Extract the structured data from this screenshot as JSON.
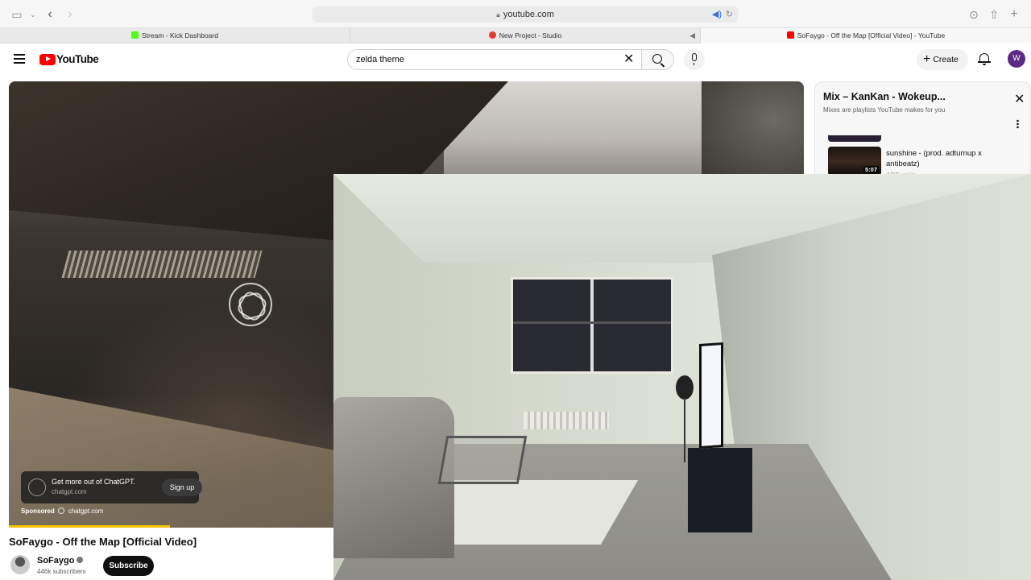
{
  "browser": {
    "url": "youtube.com",
    "tabs": [
      {
        "label": "Stream - Kick Dashboard",
        "fav_color": "#53fc18"
      },
      {
        "label": "New Project - Studio",
        "fav_color": "#e53935"
      },
      {
        "label": "SoFaygo - Off the Map [Official Video] - YouTube",
        "fav_color": "#ff0000"
      }
    ]
  },
  "youtube": {
    "logo_text": "YouTube",
    "search_value": "zelda theme",
    "create_label": "Create",
    "avatar_letter": "W"
  },
  "ad": {
    "title": "Get more out of ChatGPT.",
    "url": "chatgpt.com",
    "signup_label": "Sign up",
    "sponsored_label": "Sponsored",
    "sponsor_url": "chatgpt.com"
  },
  "video": {
    "title": "SoFaygo - Off the Map [Official Video]",
    "channel": "SoFaygo",
    "subscribers": "446k subscribers",
    "subscribe_label": "Subscribe"
  },
  "mix": {
    "title": "Mix – KanKan - Wokeup...",
    "subtitle": "Mixes are playlists YouTube makes for you",
    "item_title": "sunshine - (prod. adturnup x antibeatz)",
    "item_duration": "5:07",
    "item_artist": "ADTurnUp"
  },
  "colors": {
    "youtube_red": "#ff0000",
    "avatar_bg": "#5b2a86",
    "ad_progress": "#f2c500"
  }
}
